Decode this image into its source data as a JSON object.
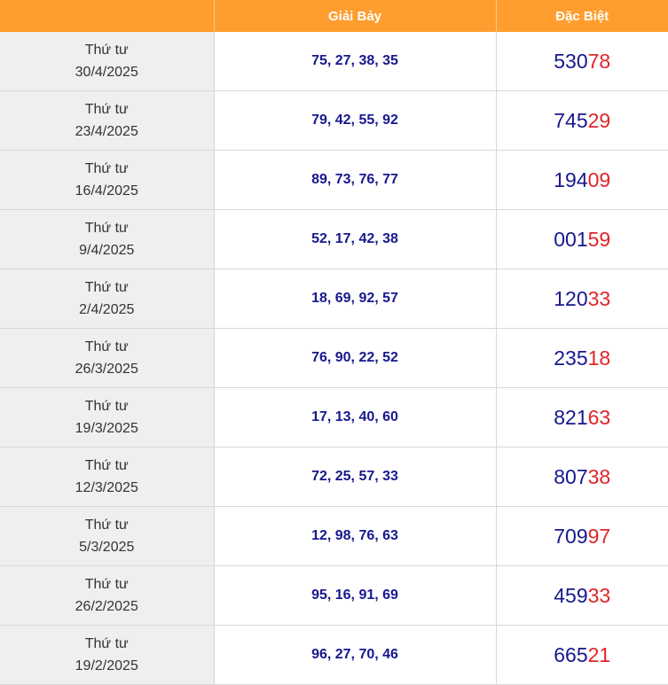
{
  "header": {
    "col_date": "",
    "col_g7": "Giải Bảy",
    "col_db": "Đặc Biệt"
  },
  "colors": {
    "header_bg": "#ff9d2e",
    "number_blue": "#17188e",
    "number_red": "#e0242a",
    "date_bg": "#efefef"
  },
  "rows": [
    {
      "weekday": "Thứ tư",
      "date": "30/4/2025",
      "g7": "75, 27, 38, 35",
      "db_head": "530",
      "db_tail": "78"
    },
    {
      "weekday": "Thứ tư",
      "date": "23/4/2025",
      "g7": "79, 42, 55, 92",
      "db_head": "745",
      "db_tail": "29"
    },
    {
      "weekday": "Thứ tư",
      "date": "16/4/2025",
      "g7": "89, 73, 76, 77",
      "db_head": "194",
      "db_tail": "09"
    },
    {
      "weekday": "Thứ tư",
      "date": "9/4/2025",
      "g7": "52, 17, 42, 38",
      "db_head": "001",
      "db_tail": "59"
    },
    {
      "weekday": "Thứ tư",
      "date": "2/4/2025",
      "g7": "18, 69, 92, 57",
      "db_head": "120",
      "db_tail": "33"
    },
    {
      "weekday": "Thứ tư",
      "date": "26/3/2025",
      "g7": "76, 90, 22, 52",
      "db_head": "235",
      "db_tail": "18"
    },
    {
      "weekday": "Thứ tư",
      "date": "19/3/2025",
      "g7": "17, 13, 40, 60",
      "db_head": "821",
      "db_tail": "63"
    },
    {
      "weekday": "Thứ tư",
      "date": "12/3/2025",
      "g7": "72, 25, 57, 33",
      "db_head": "807",
      "db_tail": "38"
    },
    {
      "weekday": "Thứ tư",
      "date": "5/3/2025",
      "g7": "12, 98, 76, 63",
      "db_head": "709",
      "db_tail": "97"
    },
    {
      "weekday": "Thứ tư",
      "date": "26/2/2025",
      "g7": "95, 16, 91, 69",
      "db_head": "459",
      "db_tail": "33"
    },
    {
      "weekday": "Thứ tư",
      "date": "19/2/2025",
      "g7": "96, 27, 70, 46",
      "db_head": "665",
      "db_tail": "21"
    }
  ]
}
